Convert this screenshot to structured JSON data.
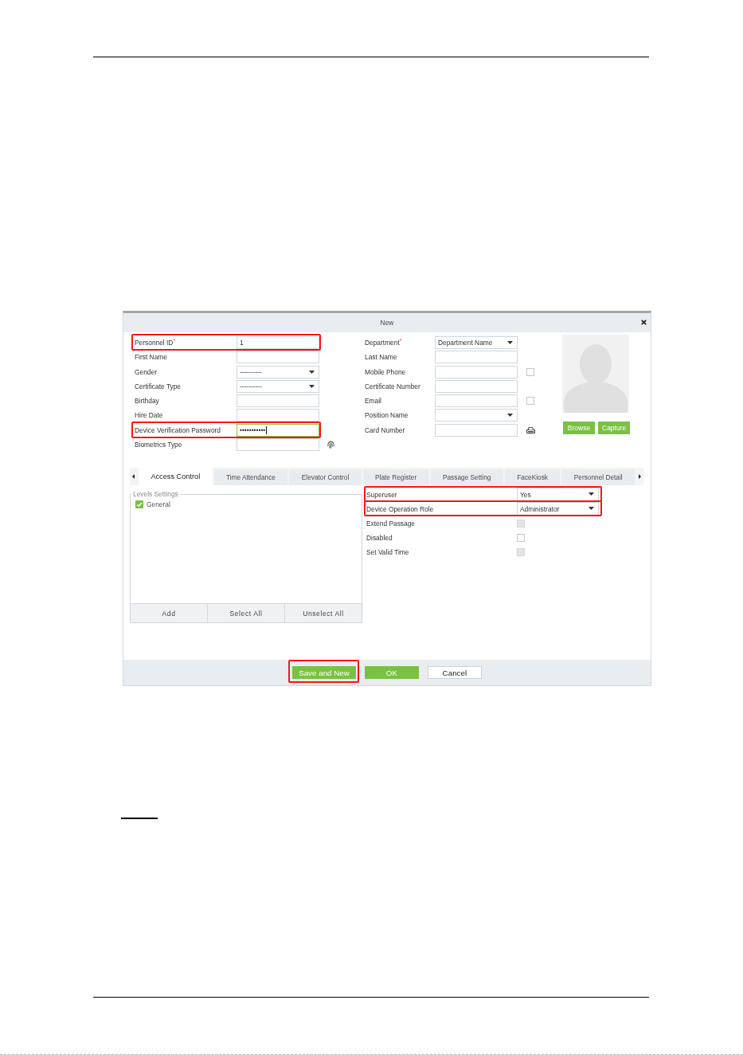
{
  "dialog": {
    "title": "New"
  },
  "form": {
    "left": [
      {
        "label": "Personnel ID$^{*}$",
        "kind": "text",
        "value": "1",
        "focused": false,
        "highlighted": true
      },
      {
        "label": "First Name",
        "kind": "text",
        "focused": false,
        "highlighted": false
      },
      {
        "label": "Gender",
        "kind": "select",
        "value": "----------",
        "focused": false,
        "highlighted": false
      },
      {
        "label": "Certificate Type",
        "kind": "select",
        "value": "----------",
        "focused": false,
        "highlighted": false
      },
      {
        "label": "Birthday",
        "kind": "text",
        "focused": false,
        "highlighted": false
      },
      {
        "label": "Hire Date",
        "kind": "text",
        "focused": false,
        "highlighted": false
      },
      {
        "label": "Device Verification Password",
        "kind": "password",
        "value": "•••••••••••",
        "focused": true,
        "highlighted": true
      },
      {
        "label": "Biometrics Type",
        "kind": "biometric",
        "focused": false,
        "highlighted": false
      }
    ],
    "right": [
      {
        "label": "Department$^{*}$",
        "kind": "select",
        "value": "Department Name",
        "focused": false,
        "highlighted": false
      },
      {
        "label": "Last Name",
        "kind": "text",
        "focused": false,
        "highlighted": false
      },
      {
        "label": "Mobile Phone",
        "kind": "text",
        "checkbox": {
          "checked": false
        },
        "focused": false,
        "highlighted": false
      },
      {
        "label": "Certificate Number",
        "kind": "text",
        "focused": false,
        "highlighted": false
      },
      {
        "label": "Email",
        "kind": "text",
        "checkbox": {
          "checked": false
        },
        "focused": false,
        "highlighted": false
      },
      {
        "label": "Position Name",
        "kind": "select",
        "focused": false,
        "highlighted": false
      },
      {
        "label": "Card Number",
        "kind": "card",
        "focused": false,
        "highlighted": false
      }
    ]
  },
  "photo_buttons": [
    "Browse",
    "Capture"
  ],
  "tabs": [
    {
      "label": "Access Control",
      "selected": true
    },
    {
      "label": "Time Attendance",
      "selected": false
    },
    {
      "label": "Elevator Control",
      "selected": false
    },
    {
      "label": "Plate Register",
      "selected": false
    },
    {
      "label": "Passage Setting",
      "selected": false
    },
    {
      "label": "FaceKiosk",
      "selected": false
    },
    {
      "label": "Personnel Detail",
      "selected": false
    }
  ],
  "levels": {
    "title": "Levels Settings",
    "items": [
      {
        "label": "General",
        "checked": true
      }
    ],
    "buttons": [
      "Add",
      "Select All",
      "Unselect All"
    ]
  },
  "settings": [
    {
      "label": "Superuser",
      "kind": "select",
      "value": "Yes",
      "highlighted": true
    },
    {
      "label": "Device Operation Role",
      "kind": "select",
      "value": "Administrator",
      "highlighted": true
    },
    {
      "label": "Extend Passage",
      "kind": "checkbox",
      "checked": false,
      "disabled": true,
      "highlighted": false
    },
    {
      "label": "Disabled",
      "kind": "checkbox",
      "checked": false,
      "disabled": false,
      "highlighted": false
    },
    {
      "label": "Set Valid Time",
      "kind": "checkbox",
      "checked": false,
      "disabled": true,
      "highlighted": false
    }
  ],
  "footer_buttons": [
    {
      "label": "Save and New",
      "kind": "primary",
      "highlighted": true
    },
    {
      "label": "OK",
      "kind": "primary",
      "highlighted": false
    },
    {
      "label": "Cancel",
      "kind": "secondary",
      "highlighted": false
    }
  ]
}
